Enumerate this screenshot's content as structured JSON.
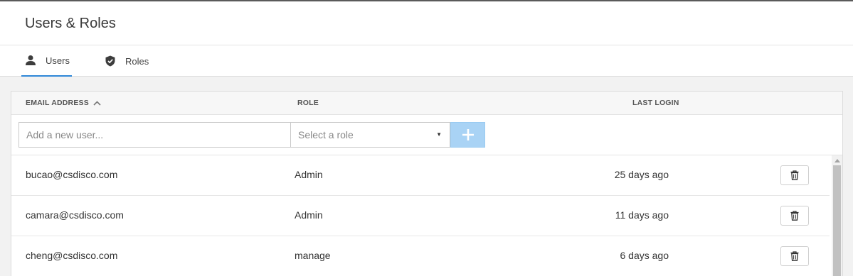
{
  "header": {
    "title": "Users & Roles"
  },
  "tabs": [
    {
      "label": "Users",
      "icon": "user-icon",
      "active": true
    },
    {
      "label": "Roles",
      "icon": "shield-icon",
      "active": false
    }
  ],
  "table": {
    "columns": {
      "email": "EMAIL ADDRESS",
      "role": "ROLE",
      "last_login": "LAST LOGIN"
    },
    "sort": {
      "column": "email",
      "direction": "ascending"
    },
    "add_row": {
      "email_placeholder": "Add a new user...",
      "role_placeholder": "Select a role",
      "add_icon": "plus-icon"
    },
    "rows": [
      {
        "email": "bucao@csdisco.com",
        "role": "Admin",
        "last_login": "25 days ago"
      },
      {
        "email": "camara@csdisco.com",
        "role": "Admin",
        "last_login": "11 days ago"
      },
      {
        "email": "cheng@csdisco.com",
        "role": "manage",
        "last_login": "6 days ago"
      }
    ],
    "row_action_icon": "trash-icon"
  },
  "colors": {
    "accent": "#2e87d8",
    "add_button": "#a9d3f5",
    "header_bg": "#f7f7f7",
    "page_bg": "#f2f2f2"
  }
}
